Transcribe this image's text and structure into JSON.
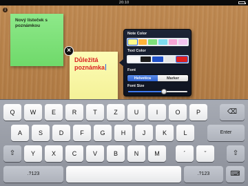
{
  "status_bar": {
    "time": "20:10"
  },
  "info_button": {
    "glyph": "i"
  },
  "notes": [
    {
      "text": "Nový lísteček s poznámkou",
      "color": "#7ee07a"
    },
    {
      "text": "Důležitá poznámka",
      "color": "#f8f59f",
      "text_color": "#d92020"
    }
  ],
  "close_button": {
    "glyph": "×"
  },
  "popover": {
    "note_color_label": "Note Color",
    "note_colors": [
      "#fff98a",
      "#ffb43a",
      "#7ee07a",
      "#7edcef",
      "#f6a5d6",
      "#f2c4f0"
    ],
    "note_color_selected": 0,
    "text_color_label": "Text Color",
    "text_colors": [
      "#f7f7f7",
      "#1c1c1c",
      "#1f50c8",
      "#e6e6e6",
      "#e02020"
    ],
    "text_color_selected": 4,
    "font_label": "Font",
    "fonts": [
      "Helvetica",
      "Marker"
    ],
    "font_selected": "Helvetica",
    "font_size_label": "Font Size",
    "font_size_value": 0.6
  },
  "keyboard": {
    "row1": [
      "Q",
      "W",
      "E",
      "R",
      "T",
      "Z",
      "U",
      "I",
      "O",
      "P"
    ],
    "row2": [
      "A",
      "S",
      "D",
      "F",
      "G",
      "H",
      "J",
      "K",
      "L"
    ],
    "row3": [
      "Y",
      "X",
      "C",
      "V",
      "B",
      "N",
      "M",
      "´",
      "ˇ"
    ],
    "backspace_glyph": "⌫",
    "enter_label": "Enter",
    "shift_glyph": "⇧",
    "numbers_label": ".?123",
    "hide_glyph": "⌨"
  }
}
